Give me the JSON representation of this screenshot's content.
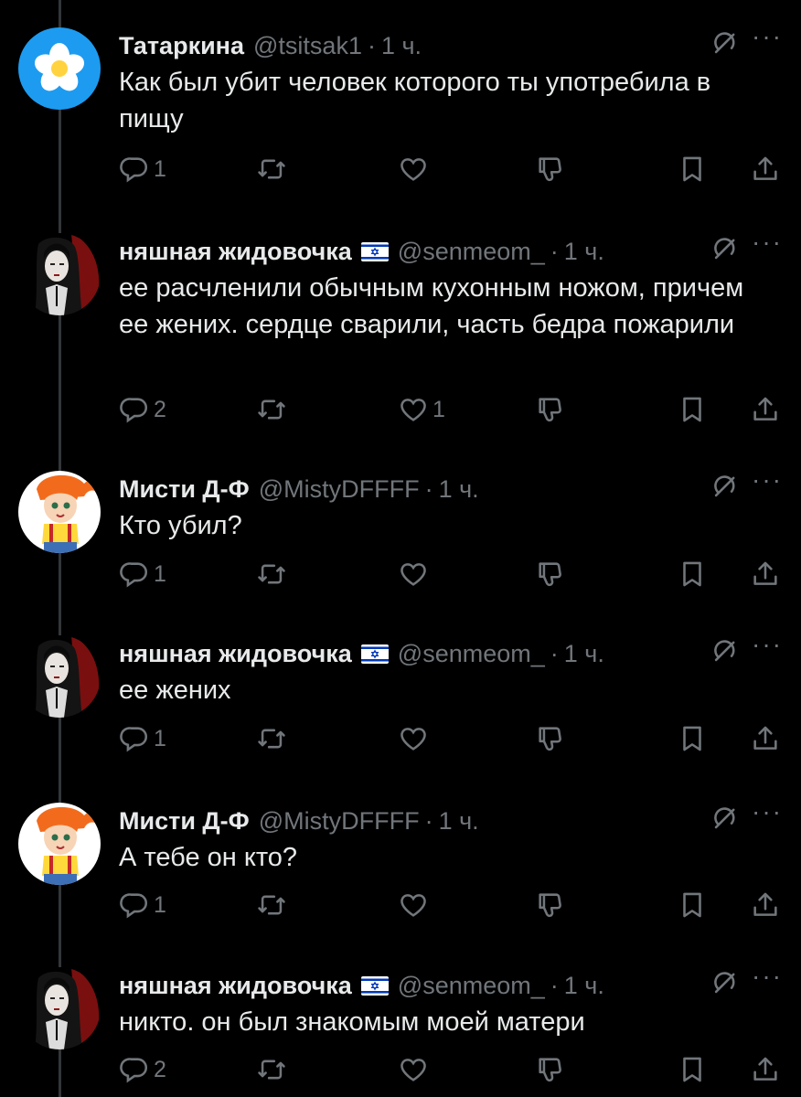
{
  "tweets": [
    {
      "name": "Татаркина",
      "handle": "@tsitsak1",
      "time": "1 ч.",
      "flag": false,
      "avatar": "flower-avatar",
      "text": "Как был убит человек которого ты употребила в пищу",
      "replies": "1",
      "retweets": "",
      "likes": ""
    },
    {
      "name": "няшная жидовочка",
      "handle": "@senmeom_",
      "time": "1 ч.",
      "flag": true,
      "avatar": "goth-girl-avatar",
      "text": "ее расчленили обычным кухонным ножом, причем ее жених. сердце сварили, часть бедра пожарили",
      "replies": "2",
      "retweets": "",
      "likes": "1"
    },
    {
      "name": "Мисти Д-Ф",
      "handle": "@MistyDFFFF",
      "time": "1 ч.",
      "flag": false,
      "avatar": "misty-avatar",
      "text": "Кто убил?",
      "replies": "1",
      "retweets": "",
      "likes": ""
    },
    {
      "name": "няшная жидовочка",
      "handle": "@senmeom_",
      "time": "1 ч.",
      "flag": true,
      "avatar": "goth-girl-avatar",
      "text": "ее жених",
      "replies": "1",
      "retweets": "",
      "likes": ""
    },
    {
      "name": "Мисти Д-Ф",
      "handle": "@MistyDFFFF",
      "time": "1 ч.",
      "flag": false,
      "avatar": "misty-avatar",
      "text": "А тебе он кто?",
      "replies": "1",
      "retweets": "",
      "likes": ""
    },
    {
      "name": "няшная жидовочка",
      "handle": "@senmeom_",
      "time": "1 ч.",
      "flag": true,
      "avatar": "goth-girl-avatar",
      "text": "никто. он был знакомым моей матери",
      "replies": "2",
      "retweets": "",
      "likes": ""
    }
  ],
  "colors": {
    "background": "#000000",
    "text": "#e7e9ea",
    "muted": "#71767b",
    "thread_line": "#333639"
  }
}
